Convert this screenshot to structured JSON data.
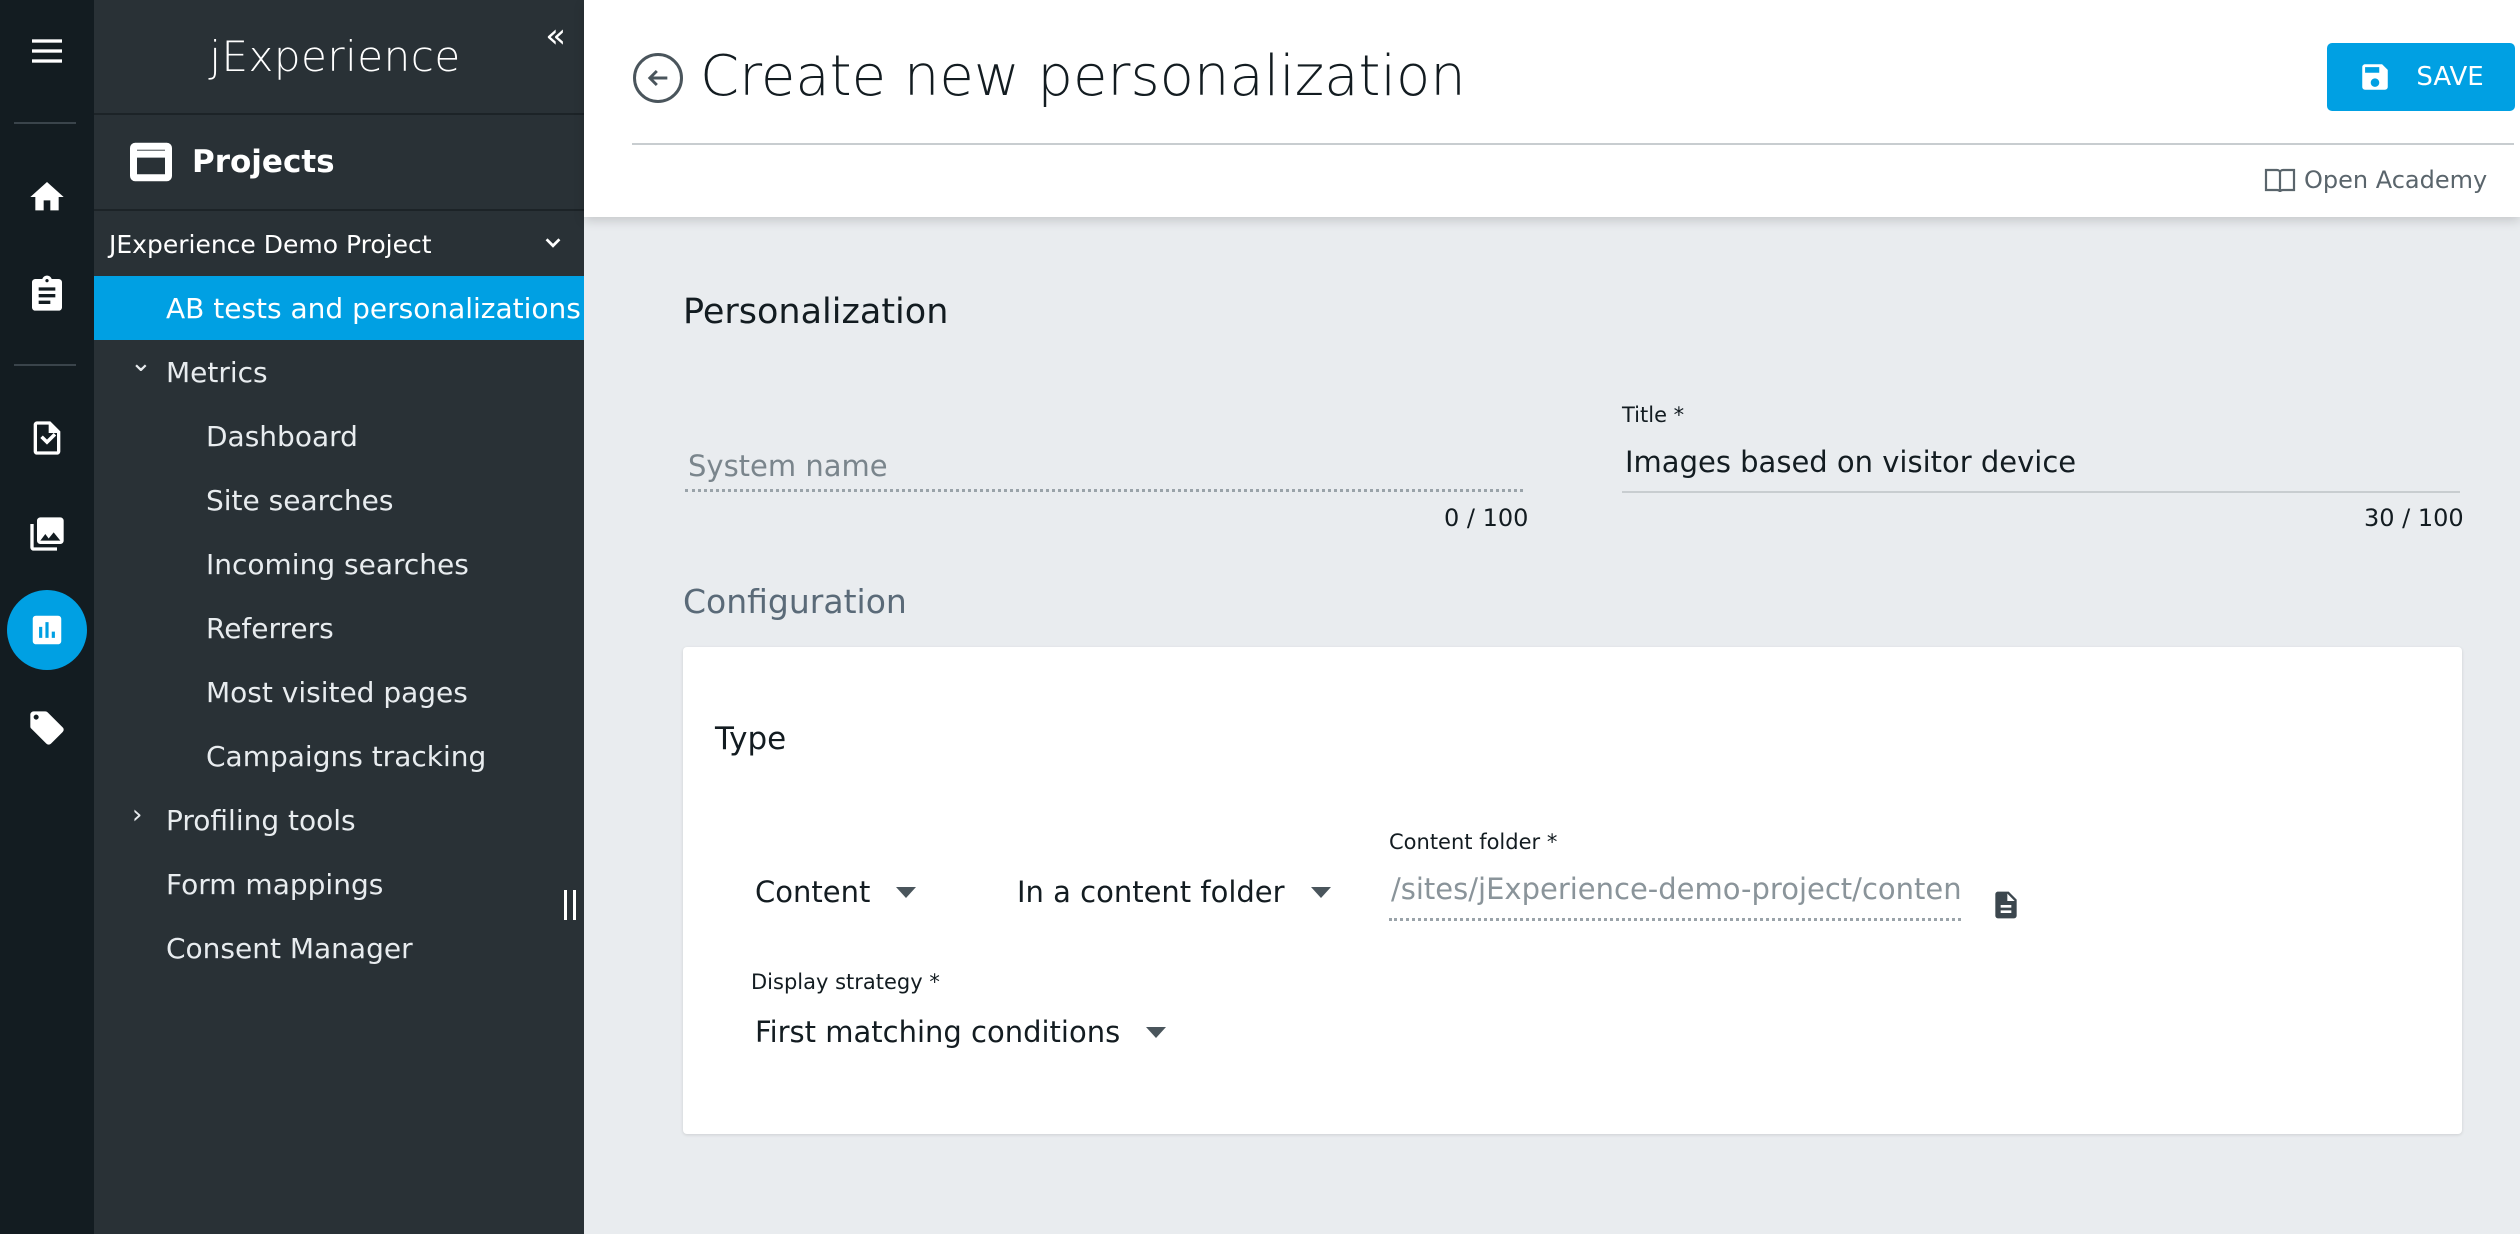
{
  "app": {
    "brand": "jExperience"
  },
  "rail": {
    "items": [
      {
        "icon": "menu-icon"
      },
      {
        "icon": "home-icon"
      },
      {
        "icon": "clipboard-icon"
      },
      {
        "icon": "document-settings-icon"
      },
      {
        "icon": "images-icon"
      },
      {
        "icon": "analytics-icon",
        "active": true
      },
      {
        "icon": "tag-icon"
      }
    ],
    "accent": "#00a0e3"
  },
  "sidebar": {
    "collapse_glyph": "«",
    "projects_label": "Projects",
    "project_name": "JExperience Demo Project",
    "items": [
      {
        "label": "AB tests and personalizations",
        "active": true
      },
      {
        "label": "Metrics",
        "caret": "⌄"
      },
      {
        "label": "Dashboard"
      },
      {
        "label": "Site searches"
      },
      {
        "label": "Incoming searches"
      },
      {
        "label": "Referrers"
      },
      {
        "label": "Most visited pages"
      },
      {
        "label": "Campaigns tracking"
      },
      {
        "label": "Profiling tools",
        "caret": "›"
      },
      {
        "label": "Form mappings"
      },
      {
        "label": "Consent Manager"
      }
    ]
  },
  "header": {
    "title": "Create new personalization",
    "save_label": "SAVE",
    "academy_label": "Open Academy"
  },
  "form": {
    "section_title": "Personalization",
    "system_name": {
      "placeholder": "System name",
      "counter": "0 / 100"
    },
    "title_field": {
      "label": "Title *",
      "value": "Images based on visitor device",
      "counter": "30 / 100"
    },
    "configuration_title": "Configuration",
    "type": {
      "title": "Type",
      "kind": "Content",
      "location": "In a content folder",
      "folder_label": "Content folder *",
      "folder_value": "/sites/jExperience-demo-project/contents",
      "strategy_label": "Display strategy *",
      "strategy_value": "First matching conditions"
    }
  }
}
